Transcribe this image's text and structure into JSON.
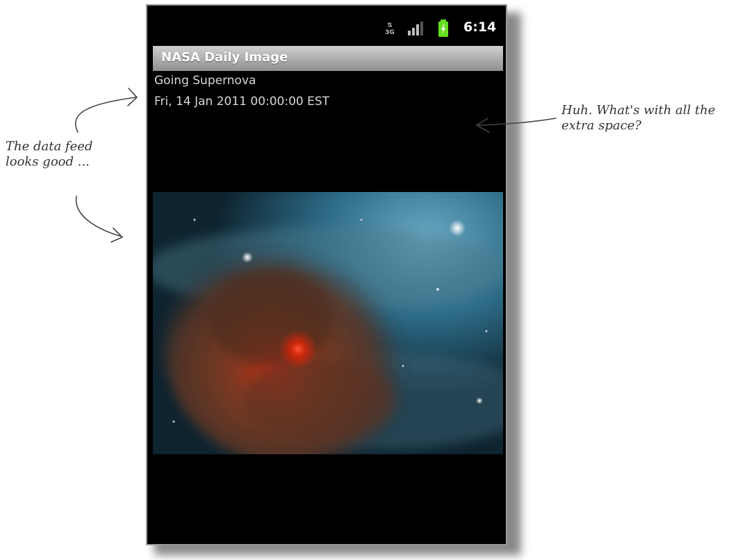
{
  "status_bar": {
    "network": "3G",
    "time": "6:14"
  },
  "app": {
    "title": "NASA Daily Image"
  },
  "feed": {
    "title": "Going Supernova",
    "date": "Fri, 14 Jan 2011 00:00:00 EST"
  },
  "image": {
    "subject": "supernova nebula"
  },
  "annotations": {
    "left_line1": "The data feed",
    "left_line2": "looks good ...",
    "right_line1": "Huh. What's with all the",
    "right_line2": "extra space?"
  },
  "colors": {
    "title_bar": "#a8a8a8",
    "battery": "#66dd22",
    "background": "#000000"
  }
}
